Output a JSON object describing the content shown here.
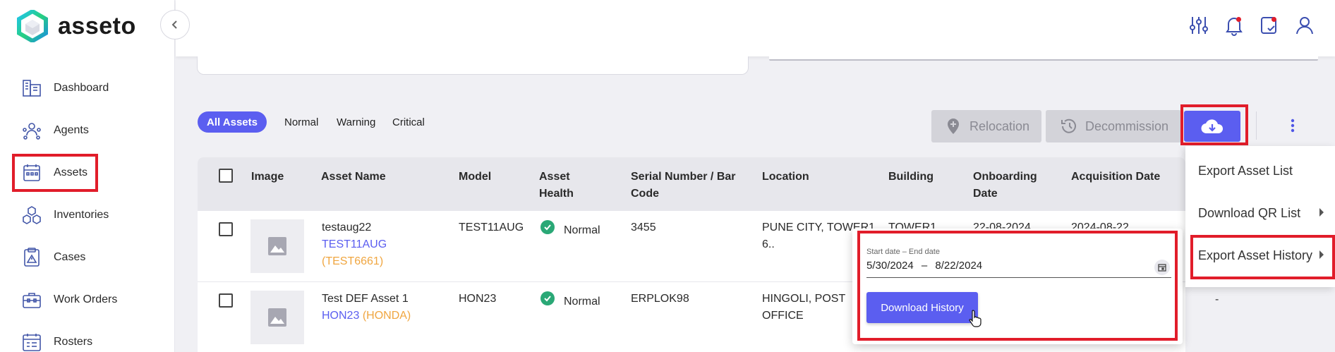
{
  "brand": {
    "name": "asseto"
  },
  "sidebar": {
    "items": [
      {
        "label": "Dashboard",
        "icon": "dashboard-icon"
      },
      {
        "label": "Agents",
        "icon": "agents-icon"
      },
      {
        "label": "Assets",
        "icon": "assets-icon"
      },
      {
        "label": "Inventories",
        "icon": "inventories-icon"
      },
      {
        "label": "Cases",
        "icon": "cases-icon"
      },
      {
        "label": "Work Orders",
        "icon": "work-orders-icon"
      },
      {
        "label": "Rosters",
        "icon": "rosters-icon"
      }
    ]
  },
  "header": {
    "icons": [
      "filter-sliders-icon",
      "bell-icon",
      "tasks-icon",
      "user-icon"
    ]
  },
  "filters": {
    "tabs": [
      {
        "label": "All Assets",
        "active": true
      },
      {
        "label": "Normal",
        "active": false
      },
      {
        "label": "Warning",
        "active": false
      },
      {
        "label": "Critical",
        "active": false
      }
    ]
  },
  "actions": {
    "relocation": "Relocation",
    "decommission": "Decommission"
  },
  "table": {
    "columns": [
      "Image",
      "Asset Name",
      "Model",
      "Asset Health",
      "Serial Number / Bar Code",
      "Location",
      "Building",
      "Onboarding Date",
      "Acquisition Date"
    ],
    "rows": [
      {
        "name": "testaug22",
        "model_link": "TEST11AUG",
        "brand": "(TEST6661)",
        "model": "TEST11AUG",
        "health": "Normal",
        "serial": "3455",
        "location": "PUNE CITY, TOWER1 6..",
        "building": "TOWER1",
        "onboarding": "22-08-2024",
        "acquisition": "2024-08-22"
      },
      {
        "name": "Test DEF Asset 1",
        "model_link": "HON23",
        "brand": "(HONDA)",
        "model": "HON23",
        "health": "Normal",
        "serial": "ERPLOK98",
        "location": "HINGOLI, POST OFFICE",
        "building": "",
        "onboarding": "",
        "acquisition": "-"
      }
    ]
  },
  "date_popup": {
    "label": "Start date – End date",
    "start": "5/30/2024",
    "separator": "–",
    "end": "8/22/2024",
    "button": "Download History"
  },
  "export_menu": {
    "items": [
      "Export Asset List",
      "Download QR List",
      "Export Asset History"
    ]
  },
  "colors": {
    "accent": "#5b5ef0",
    "highlight": "#e11d2a",
    "healthy": "#2aa876",
    "brand_orange": "#f0a640"
  }
}
